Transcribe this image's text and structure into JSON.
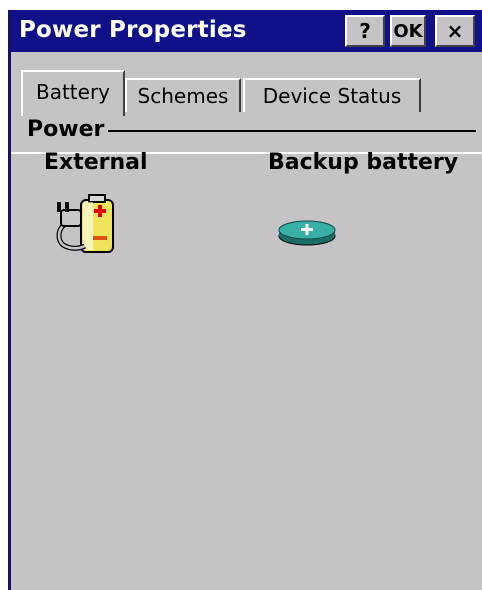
{
  "window": {
    "title": "Power Properties",
    "help_label": "?",
    "ok_label": "OK",
    "close_label": "×"
  },
  "tabs": [
    {
      "label": "Battery",
      "active": true
    },
    {
      "label": "Schemes",
      "active": false
    },
    {
      "label": "Device Status",
      "active": false
    }
  ],
  "power": {
    "section_label": "Power",
    "external_label": "External",
    "backup_label": "Backup battery",
    "external_icon": "plug-battery-icon",
    "backup_icon": "coin-battery-icon"
  },
  "colors": {
    "titlebar": "#101089",
    "window_bg": "#c6c3c6",
    "coin_cell": "#2e9a92"
  }
}
